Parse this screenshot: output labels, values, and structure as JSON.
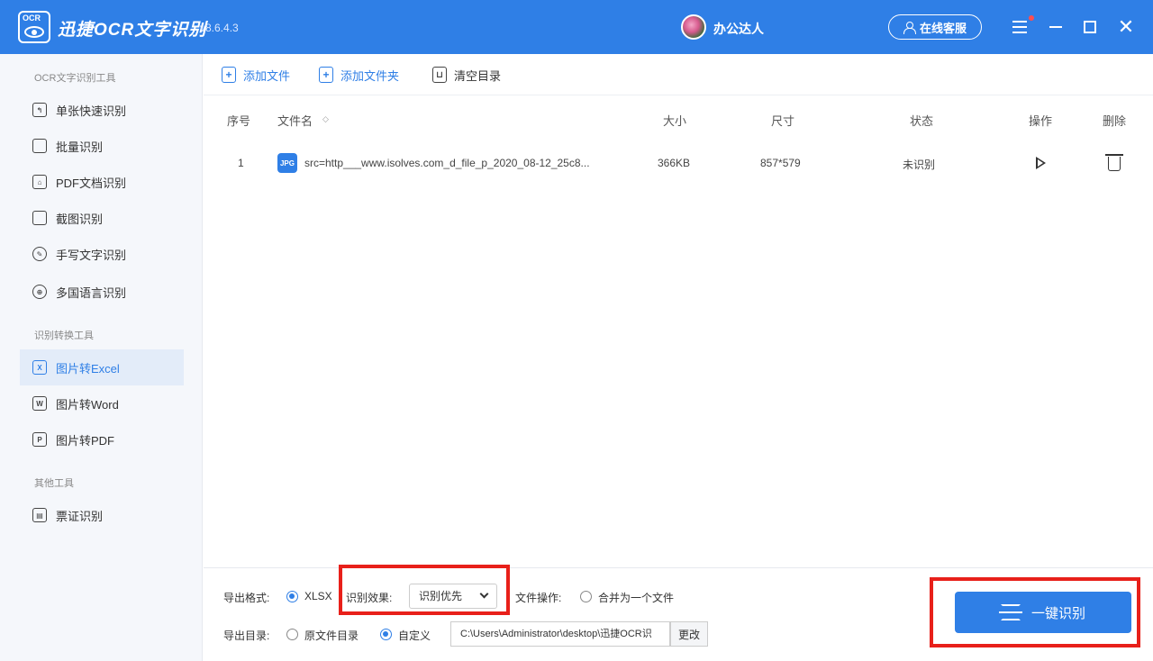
{
  "titlebar": {
    "logo_text": "OCR",
    "app_name": "迅捷OCR文字识别",
    "version": "v8.6.4.3",
    "user_name": "办公达人",
    "support_label": "在线客服",
    "close_glyph": "✕"
  },
  "sidebar": {
    "section1": "OCR文字识别工具",
    "section2": "识别转换工具",
    "section3": "其他工具",
    "items": [
      {
        "label": "单张快速识别",
        "glyph": "↰"
      },
      {
        "label": "批量识别",
        "glyph": ""
      },
      {
        "label": "PDF文档识别",
        "glyph": "⌂"
      },
      {
        "label": "截图识别",
        "glyph": ""
      },
      {
        "label": "手写文字识别",
        "glyph": "✎"
      },
      {
        "label": "多国语言识别",
        "glyph": "⊕"
      },
      {
        "label": "图片转Excel",
        "glyph": "X"
      },
      {
        "label": "图片转Word",
        "glyph": "W"
      },
      {
        "label": "图片转PDF",
        "glyph": "P"
      },
      {
        "label": "票证识别",
        "glyph": "▤"
      }
    ]
  },
  "toolbar": {
    "add_file": "添加文件",
    "add_folder": "添加文件夹",
    "clear_list": "清空目录",
    "plus_glyph": "+",
    "trash_glyph": "⊔"
  },
  "table": {
    "headers": {
      "index": "序号",
      "filename": "文件名",
      "sort_glyph": "◇",
      "size": "大小",
      "dimensions": "尺寸",
      "status": "状态",
      "action": "操作",
      "delete": "删除"
    },
    "rows": [
      {
        "index": "1",
        "icon_text": "JPG",
        "filename": "src=http___www.isolves.com_d_file_p_2020_08-12_25c8...",
        "size": "366KB",
        "dimensions": "857*579",
        "status": "未识别"
      }
    ]
  },
  "bottom": {
    "export_format_label": "导出格式:",
    "format_xlsx": "XLSX",
    "recog_effect_label": "识别效果:",
    "recog_effect_value": "识别优先",
    "file_op_label": "文件操作:",
    "merge_label": "合并为一个文件",
    "export_dir_label": "导出目录:",
    "original_dir": "原文件目录",
    "custom_dir": "自定义",
    "path_value": "C:\\Users\\Administrator\\desktop\\迅捷OCR识",
    "change_label": "更改",
    "start_label": "一键识别"
  }
}
